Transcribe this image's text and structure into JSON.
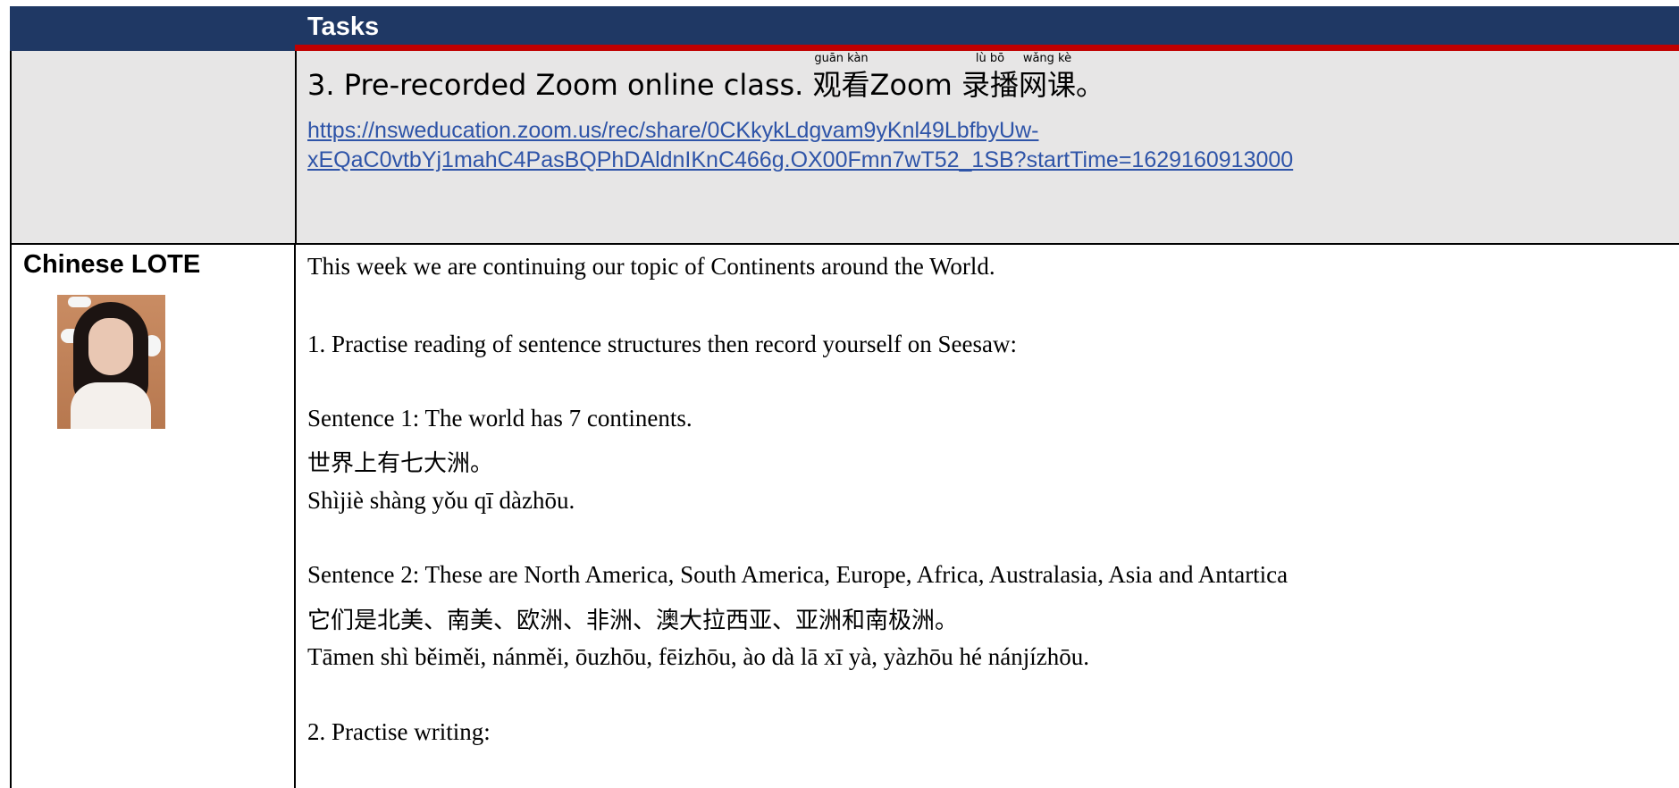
{
  "header": {
    "title": "Tasks"
  },
  "zoom": {
    "title_prefix": "3. Pre-recorded Zoom online class. ",
    "ruby": [
      {
        "base": "观看",
        "reading": "guān kàn"
      },
      {
        "base": "Zoom ",
        "reading": ""
      },
      {
        "base": "录播",
        "reading": "lù  bō"
      },
      {
        "base": "网课",
        "reading": "wǎng kè"
      }
    ],
    "title_suffix": "。",
    "link_line1": "https://nsweducation.zoom.us/rec/share/0CKkykLdgvam9yKnl49LbfbyUw-",
    "link_line2": "xEQaC0vtbYj1mahC4PasBQPhDAldnIKnC466g.OX00Fmn7wT52_1SB?startTime=1629160913000"
  },
  "subject": {
    "name": "Chinese LOTE"
  },
  "lines": [
    "This week we are continuing our topic of Continents around the World.",
    "1. Practise reading of sentence structures then record yourself on Seesaw:",
    "Sentence 1: The world has 7 continents.",
    "世界上有七大洲。",
    "Shìjiè shàng yǒu qī dàzhōu.",
    "Sentence 2: These are North America, South America, Europe, Africa, Australasia, Asia and Antartica",
    "它们是北美、南美、欧洲、非洲、澳大拉西亚、亚洲和南极洲。",
    "Tāmen shì běiměi, nánměi, ōuzhōu, fēizhōu, ào dà lā xī yà, yàzhōu hé nánjízhōu.",
    "2. Practise writing:"
  ]
}
